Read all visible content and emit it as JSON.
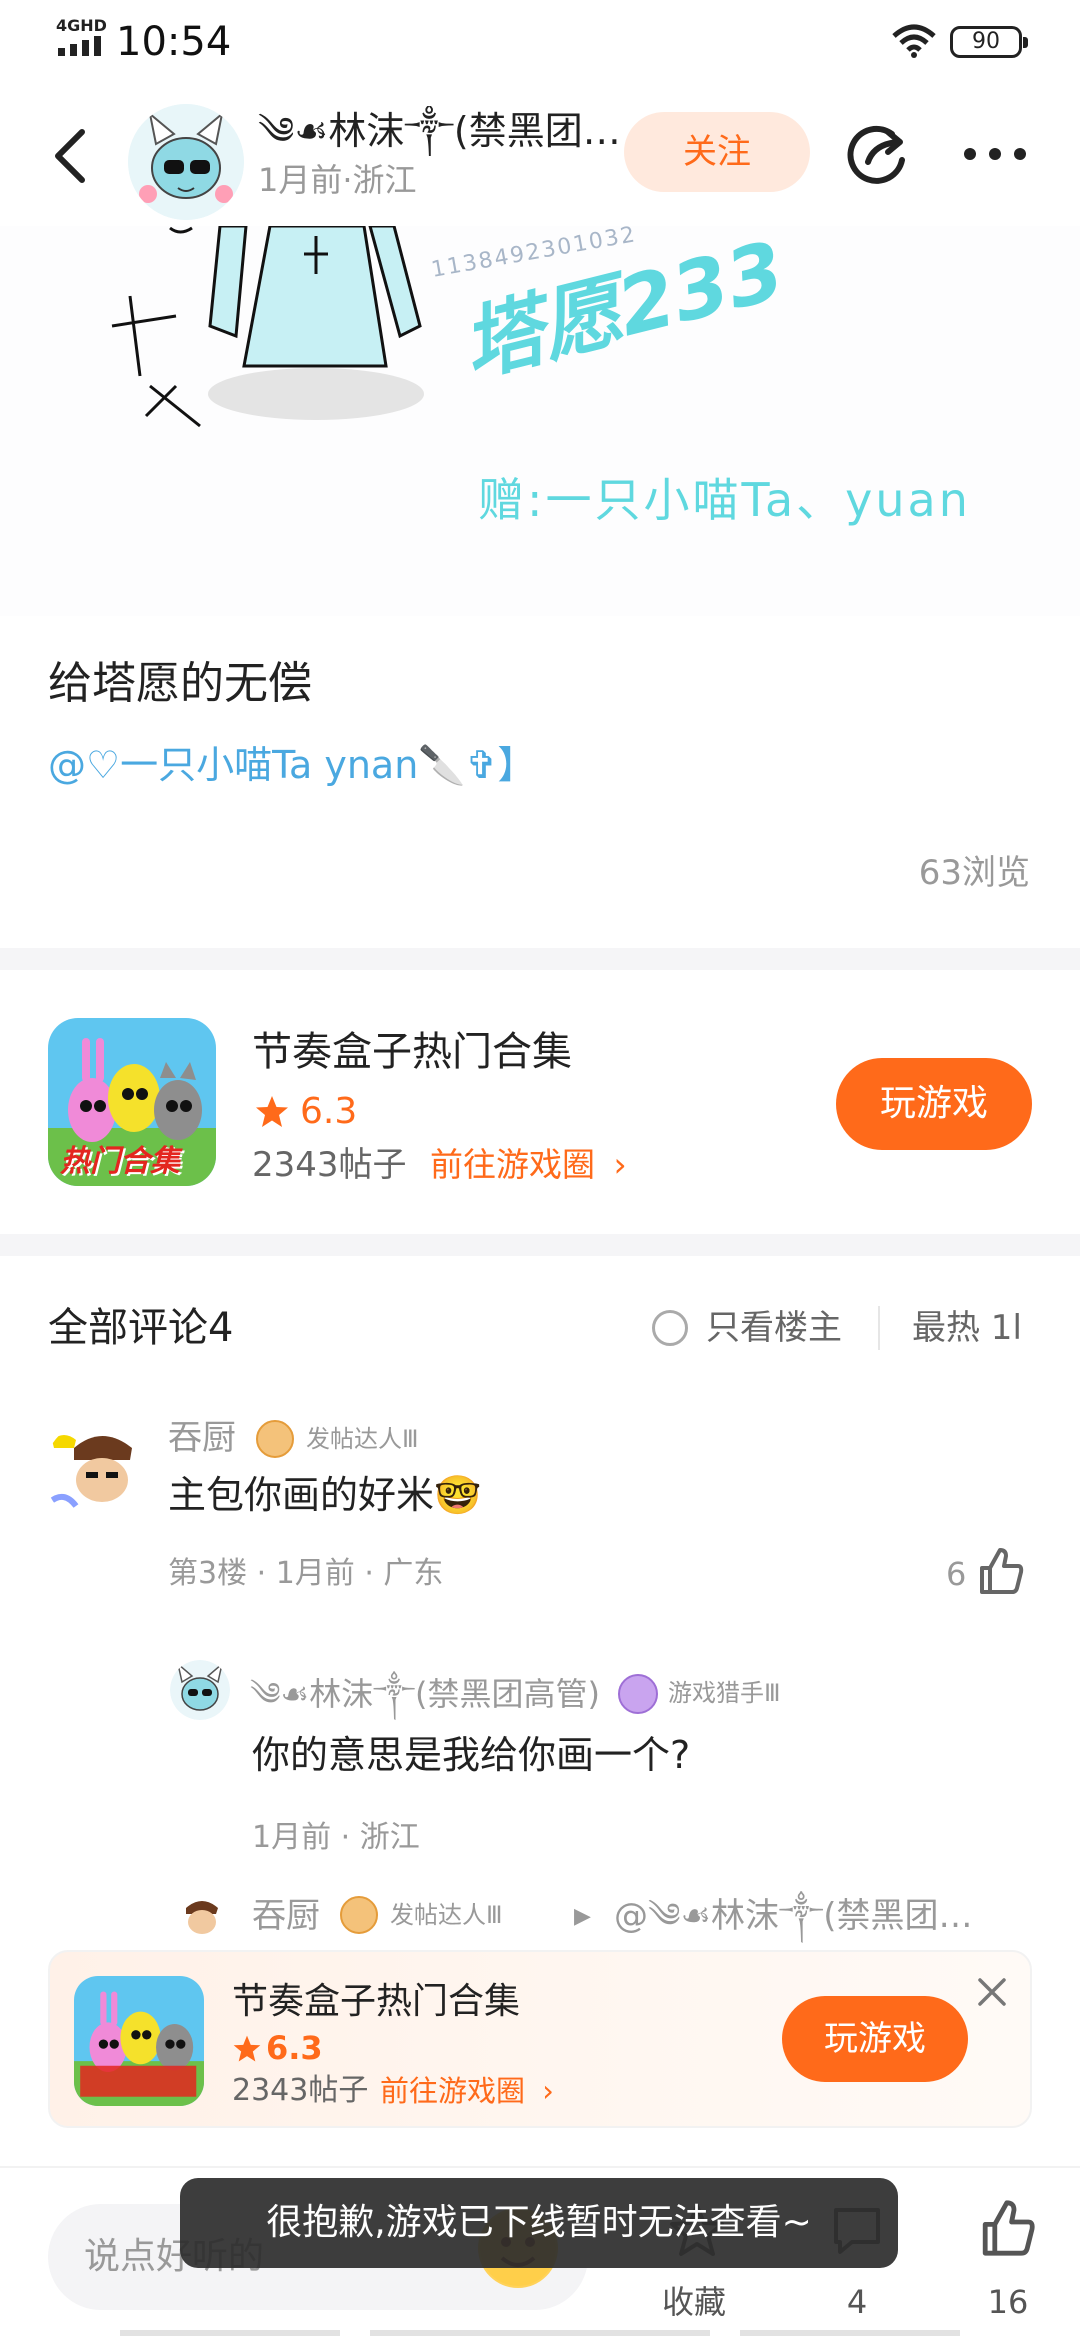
{
  "status_bar": {
    "network": "4GHD",
    "time": "10:54",
    "battery": "90"
  },
  "header": {
    "author_name": "༄☙林沫༒(禁黑团…",
    "post_meta": "1月前·浙江",
    "follow_label": "关注"
  },
  "artwork": {
    "watermark": "塔愿233",
    "id_text": "1138492301032",
    "gift_text": "赠:一只小喵Ta、yuan"
  },
  "post": {
    "title": "给塔愿的无偿",
    "mention": "@♡一只小喵Ta ynan🔪✞】",
    "views": "63浏览"
  },
  "game_card": {
    "name": "节奏盒子热门合集",
    "rating": "6.3",
    "posts": "2343帖子",
    "circle_link": "前往游戏圈",
    "play_label": "玩游戏",
    "icon_text": "热门合集"
  },
  "comments_header": {
    "title": "全部评论4",
    "op_only": "只看楼主",
    "sort": "最热 1l"
  },
  "comments": [
    {
      "name": "吞厨",
      "badge": "发帖达人Ⅲ",
      "text": "主包你画的好米🤓",
      "meta": "第3楼 · 1月前 · 广东",
      "likes": "6"
    }
  ],
  "replies": [
    {
      "name": "༄☙林沫༒(禁黑团高管)",
      "badge": "游戏猎手Ⅲ",
      "text": "你的意思是我给你画一个?",
      "meta": "1月前 · 浙江"
    },
    {
      "name": "吞厨",
      "badge": "发帖达人Ⅲ",
      "reply_to": "@༄☙林沫༒(禁黑团…"
    }
  ],
  "banner": {
    "name": "节奏盒子热门合集",
    "rating": "6.3",
    "posts": "2343帖子",
    "circle_link": "前往游戏圈",
    "play_label": "玩游戏"
  },
  "bottom_bar": {
    "input_placeholder": "说点好听的",
    "collect_label": "收藏",
    "comment_count": "4",
    "like_count": "16"
  },
  "toast": "很抱歉,游戏已下线暂时无法查看~",
  "colors": {
    "accent": "#ff6a1a",
    "mention": "#4aa8e0",
    "art_cyan": "#5fd8df"
  }
}
